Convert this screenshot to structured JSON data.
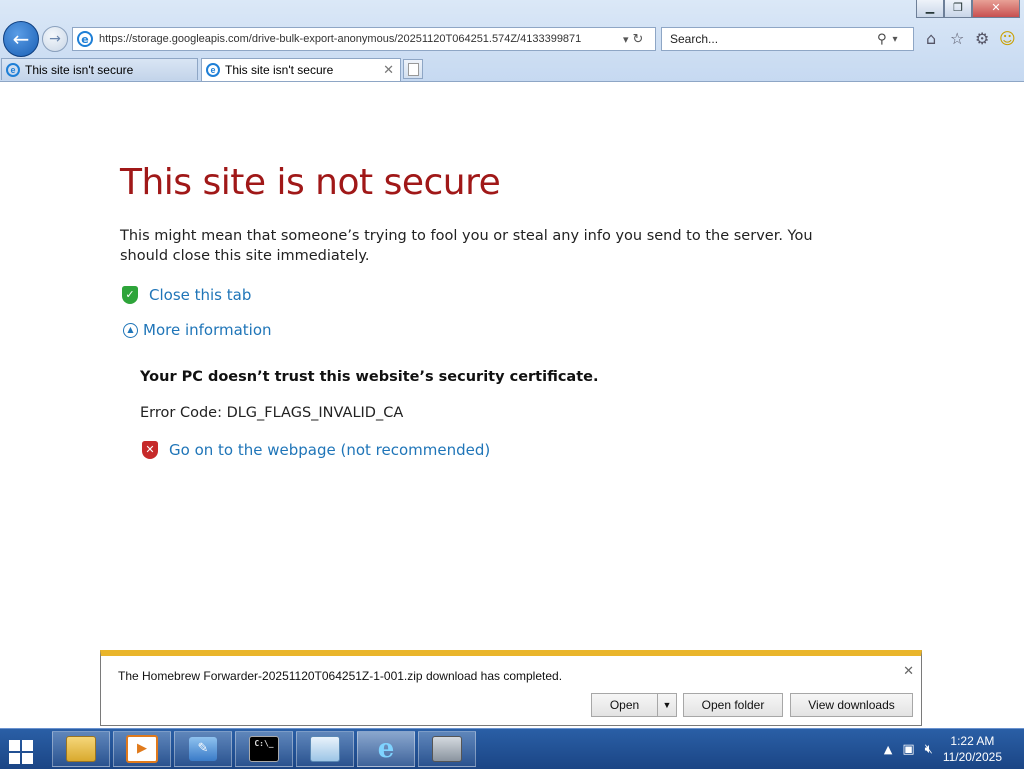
{
  "browser": {
    "url": "https://storage.googleapis.com/drive-bulk-export-anonymous/20251120T064251.574Z/4133399871",
    "search_placeholder": "Search...",
    "tabs": [
      {
        "label": "This site isn't secure",
        "active": false
      },
      {
        "label": "This site isn't secure",
        "active": true
      }
    ],
    "window_buttons": {
      "minimize": "▁",
      "maximize": "❐",
      "close": "✕"
    },
    "toolbar_icons": [
      "home-icon",
      "favorites-star-icon",
      "tools-gear-icon",
      "smiley-feedback-icon"
    ]
  },
  "page": {
    "title": "This site is not secure",
    "description": "This might mean that someone’s trying to fool you or steal any info you send to the server. You should close this site immediately.",
    "close_tab_link": "Close this tab",
    "more_info_link": "More information",
    "cert_warning": "Your PC doesn’t trust this website’s security certificate.",
    "error_code": "Error Code: DLG_FLAGS_INVALID_CA",
    "proceed_link": "Go on to the webpage (not recommended)",
    "colors": {
      "title": "#a01818",
      "link": "#1f75b8"
    }
  },
  "download_bar": {
    "message": "The Homebrew Forwarder-20251120T064251Z-1-001.zip download has completed.",
    "open_label": "Open",
    "open_folder_label": "Open folder",
    "view_downloads_label": "View downloads",
    "accent_color": "#e9b52b"
  },
  "taskbar": {
    "apps": [
      "file-explorer-icon",
      "media-player-icon",
      "feather-app-icon",
      "command-prompt-icon",
      "notepad-icon",
      "internet-explorer-icon",
      "device-app-icon"
    ],
    "cmd_glyph": "C:\\_",
    "time": "1:22 AM",
    "date": "11/20/2025"
  }
}
